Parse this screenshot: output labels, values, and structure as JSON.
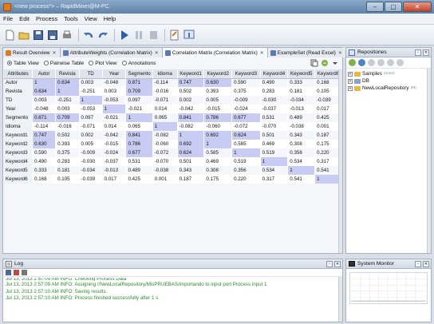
{
  "window": {
    "title": "<new process*> – RapidMiner@M-PC"
  },
  "menu": [
    "File",
    "Edit",
    "Process",
    "Tools",
    "View",
    "Help"
  ],
  "tabs": [
    {
      "label": "Result Overview",
      "color": "#d77d22",
      "active": false
    },
    {
      "label": "AttributeWeights (Correlation Matrix)",
      "color": "#5b7bb0",
      "active": false
    },
    {
      "label": "Correlation Matrix (Correlation Matrix)",
      "color": "#5b7bb0",
      "active": true
    },
    {
      "label": "ExampleSet (Read Excel)",
      "color": "#5b7bb0",
      "active": false
    }
  ],
  "views": [
    {
      "label": "Table View",
      "selected": true
    },
    {
      "label": "Pairwise Table",
      "selected": false
    },
    {
      "label": "Plot View",
      "selected": false
    },
    {
      "label": "Annotations",
      "selected": false
    }
  ],
  "table": {
    "corner": "Attributes",
    "columns": [
      "Autor",
      "Revista",
      "TD",
      "Year",
      "Segmento",
      "Idioma",
      "Keyword1",
      "Keyword2",
      "Keyword3",
      "Keyword4",
      "Keyword5",
      "Keyword6"
    ],
    "rows": [
      {
        "name": "Autor",
        "values": [
          "1",
          "0.634",
          "0.003",
          "-0.048",
          "0.871",
          "-0.114",
          "0.747",
          "0.630",
          "0.590",
          "0.490",
          "0.333",
          "0.168"
        ]
      },
      {
        "name": "Revista",
        "values": [
          "0.634",
          "1",
          "-0.251",
          "0.003",
          "0.709",
          "-0.016",
          "0.502",
          "0.393",
          "0.375",
          "0.283",
          "0.181",
          "0.105"
        ]
      },
      {
        "name": "TD",
        "values": [
          "0.003",
          "-0.251",
          "1",
          "-0.053",
          "0.097",
          "-0.071",
          "0.002",
          "0.005",
          "-0.009",
          "-0.030",
          "-0.034",
          "-0.039"
        ]
      },
      {
        "name": "Year",
        "values": [
          "-0.048",
          "0.003",
          "-0.053",
          "1",
          "-0.021",
          "0.014",
          "-0.042",
          "-0.015",
          "-0.024",
          "-0.037",
          "-0.013",
          "0.017"
        ]
      },
      {
        "name": "Segmento",
        "values": [
          "0.871",
          "0.709",
          "0.097",
          "-0.021",
          "1",
          "0.065",
          "0.841",
          "0.786",
          "0.677",
          "0.531",
          "0.489",
          "0.425"
        ]
      },
      {
        "name": "Idioma",
        "values": [
          "-0.114",
          "-0.016",
          "-0.071",
          "0.014",
          "0.065",
          "1",
          "-0.082",
          "-0.060",
          "-0.072",
          "-0.070",
          "-0.038",
          "0.001"
        ]
      },
      {
        "name": "Keyword1",
        "values": [
          "0.747",
          "0.502",
          "0.002",
          "-0.042",
          "0.841",
          "-0.082",
          "1",
          "0.692",
          "0.624",
          "0.501",
          "0.343",
          "0.187"
        ]
      },
      {
        "name": "Keyword2",
        "values": [
          "0.630",
          "0.393",
          "0.005",
          "-0.015",
          "0.786",
          "-0.060",
          "0.692",
          "1",
          "0.585",
          "0.469",
          "0.308",
          "0.175"
        ]
      },
      {
        "name": "Keyword3",
        "values": [
          "0.590",
          "0.375",
          "-0.009",
          "-0.024",
          "0.677",
          "-0.072",
          "0.624",
          "0.585",
          "1",
          "0.519",
          "0.356",
          "0.220"
        ]
      },
      {
        "name": "Keyword4",
        "values": [
          "0.490",
          "0.283",
          "-0.030",
          "-0.037",
          "0.531",
          "-0.070",
          "0.501",
          "0.469",
          "0.519",
          "1",
          "0.534",
          "0.317"
        ]
      },
      {
        "name": "Keyword5",
        "values": [
          "0.333",
          "0.181",
          "-0.034",
          "-0.013",
          "0.489",
          "-0.038",
          "0.343",
          "0.308",
          "0.356",
          "0.534",
          "1",
          "0.541"
        ]
      },
      {
        "name": "Keyword6",
        "values": [
          "0.168",
          "0.105",
          "-0.039",
          "0.017",
          "0.425",
          "0.001",
          "0.187",
          "0.175",
          "0.220",
          "0.317",
          "0.541",
          "1"
        ]
      }
    ]
  },
  "repositories": {
    "title": "Repositories",
    "items": [
      {
        "label": "Samples",
        "note": "(none)"
      },
      {
        "label": "DB",
        "note": ""
      },
      {
        "label": "NewLocalRepository",
        "note": "(M)"
      }
    ]
  },
  "log": {
    "title": "Log",
    "lines": [
      "Jul 13, 2013 2:57:09 AM INFO: Checking Process Data",
      "Jul 13, 2013 2:57:09 AM INFO: Assigning //NewLocalRepository/MisPRUEBAS/importando to input port Process input 1",
      "Jul 13, 2013 2:57:10 AM INFO: Saving results.",
      "Jul 13, 2013 2:57:10 AM INFO: Process finished successfully after 1 s"
    ]
  },
  "sysmon": {
    "title": "System Monitor"
  }
}
